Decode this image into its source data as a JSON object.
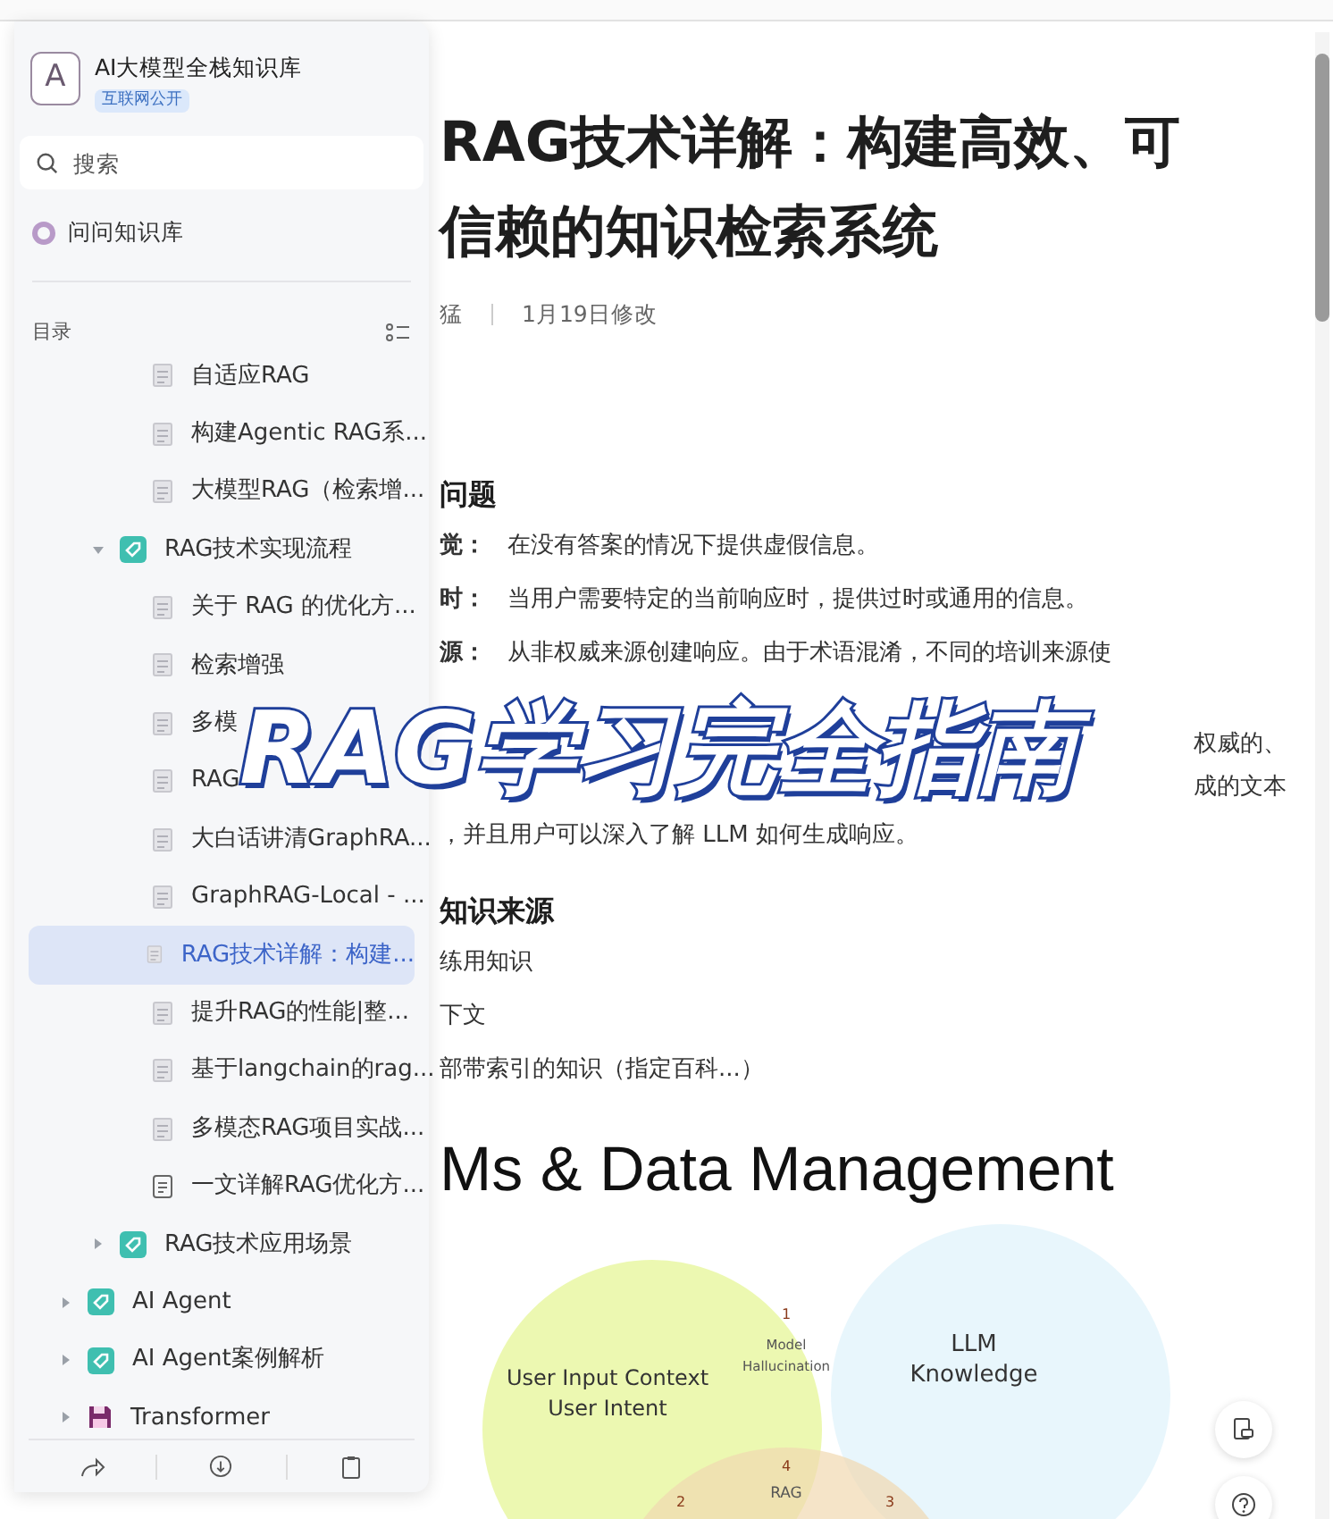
{
  "sidebar": {
    "avatar": "A",
    "title": "AI大模型全栈知识库",
    "badge": "互联网公开",
    "search": {
      "placeholder": "搜索"
    },
    "ask": "问问知识库",
    "toc_label": "目录",
    "tree": [
      {
        "kind": "folder",
        "children": [
          {
            "kind": "folder",
            "children": [
              {
                "kind": "doc",
                "label": "自适应RAG",
                "selected": false
              },
              {
                "kind": "doc",
                "label": "构建Agentic RAG系...",
                "selected": false
              },
              {
                "kind": "doc",
                "label": "大模型RAG（检索增...",
                "selected": false
              }
            ]
          },
          {
            "kind": "folder",
            "label": "RAG技术实现流程",
            "expanded": true,
            "selected": false,
            "children": [
              {
                "kind": "doc",
                "label": "关于 RAG 的优化方...",
                "selected": false
              },
              {
                "kind": "doc",
                "label": "检索增强",
                "selected": false
              },
              {
                "kind": "doc",
                "label": "多模",
                "selected": false
              },
              {
                "kind": "doc",
                "label": "RAG",
                "selected": false
              },
              {
                "kind": "doc",
                "label": "大白话讲清GraphRA...",
                "selected": false
              },
              {
                "kind": "doc",
                "label": "GraphRAG-Local - ...",
                "selected": false
              },
              {
                "kind": "doc",
                "label": "RAG技术详解：构建...",
                "selected": true
              },
              {
                "kind": "doc",
                "label": "提升RAG的性能|整...",
                "selected": false
              },
              {
                "kind": "doc",
                "label": "基于langchain的rag...",
                "selected": false
              },
              {
                "kind": "doc",
                "label": "多模态RAG项目实战...",
                "selected": false
              },
              {
                "kind": "note",
                "label": "一文详解RAG优化方...",
                "selected": false
              }
            ]
          },
          {
            "kind": "folder",
            "label": "RAG技术应用场景",
            "expanded": false,
            "selected": false
          }
        ]
      },
      {
        "kind": "folder",
        "label": "AI Agent",
        "expanded": false,
        "selected": false
      },
      {
        "kind": "folder",
        "label": "AI Agent案例解析",
        "expanded": false,
        "selected": false
      },
      {
        "kind": "disk",
        "label": "Transformer",
        "expanded": false,
        "selected": false
      }
    ]
  },
  "article": {
    "title": "RAG技术详解：构建高效、可信赖的知识检索系统",
    "author": "猛",
    "modified": "1月19日修改",
    "sections": [
      {
        "heading": "问题",
        "lines": [
          {
            "kind": "term",
            "term": "觉：",
            "text": "在没有答案的情况下提供虚假信息。"
          },
          {
            "kind": "term",
            "term": "时：",
            "text": "当用户需要特定的当前响应时，提供过时或通用的信息。"
          },
          {
            "kind": "term",
            "term": "源：",
            "text": "从非权威来源创建响应。由于术语混淆，不同的培训来源使"
          },
          {
            "kind": "right",
            "text": "权威的、"
          },
          {
            "kind": "right",
            "text": "成的文本"
          },
          {
            "kind": "plain",
            "text": "，并且用户可以深入了解 LLM 如何生成响应。"
          }
        ]
      },
      {
        "heading": "知识来源",
        "lines": [
          {
            "kind": "plain",
            "text": "练用知识"
          },
          {
            "kind": "plain",
            "text": "下文"
          },
          {
            "kind": "plain",
            "text": "部带索引的知识（指定百科...）"
          }
        ]
      }
    ],
    "figure": {
      "heading": "Ms & Data Management",
      "labels": [
        "1",
        "Model",
        "LLM",
        "User Input Context",
        "Hallucination",
        "Knowledge",
        "User Intent",
        "4",
        "RAG",
        "2",
        "3"
      ]
    }
  },
  "overlay_title": "RAG学习完全指南"
}
